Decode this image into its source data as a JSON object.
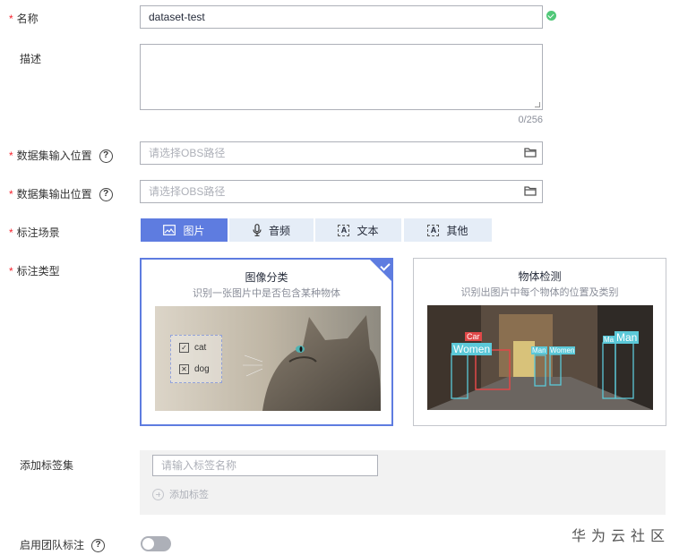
{
  "form": {
    "name": {
      "label": "名称",
      "required": true,
      "value": "dataset-test"
    },
    "description": {
      "label": "描述",
      "required": false,
      "value": "",
      "counter": "0/256"
    },
    "input_location": {
      "label": "数据集输入位置",
      "required": true,
      "placeholder": "请选择OBS路径",
      "help": "?"
    },
    "output_location": {
      "label": "数据集输出位置",
      "required": true,
      "placeholder": "请选择OBS路径",
      "help": "?"
    },
    "scene": {
      "label": "标注场景",
      "required": true,
      "options": [
        {
          "label": "图片",
          "icon": "image-icon",
          "selected": true
        },
        {
          "label": "音频",
          "icon": "microphone-icon",
          "selected": false
        },
        {
          "label": "文本",
          "icon": "text-icon",
          "icon_glyph": "A",
          "selected": false
        },
        {
          "label": "其他",
          "icon": "other-icon",
          "icon_glyph": "A",
          "selected": false
        }
      ]
    },
    "type": {
      "label": "标注类型",
      "required": true,
      "cards": [
        {
          "title": "图像分类",
          "desc": "识别一张图片中是否包含某种物体",
          "selected": true,
          "tags": [
            "cat",
            "dog"
          ]
        },
        {
          "title": "物体检测",
          "desc": "识别出图片中每个物体的位置及类别",
          "selected": false,
          "boxes": [
            "Car",
            "Women",
            "Man",
            "Women",
            "Ma",
            "Man"
          ]
        }
      ]
    },
    "label_set": {
      "label": "添加标签集",
      "placeholder": "请输入标签名称",
      "add_label": "添加标签"
    },
    "team": {
      "label": "启用团队标注",
      "help": "?",
      "enabled": false
    }
  },
  "colors": {
    "primary": "#5e7ce0",
    "required": "#f5222d",
    "success": "#50c878"
  },
  "watermark": "华为云社区"
}
